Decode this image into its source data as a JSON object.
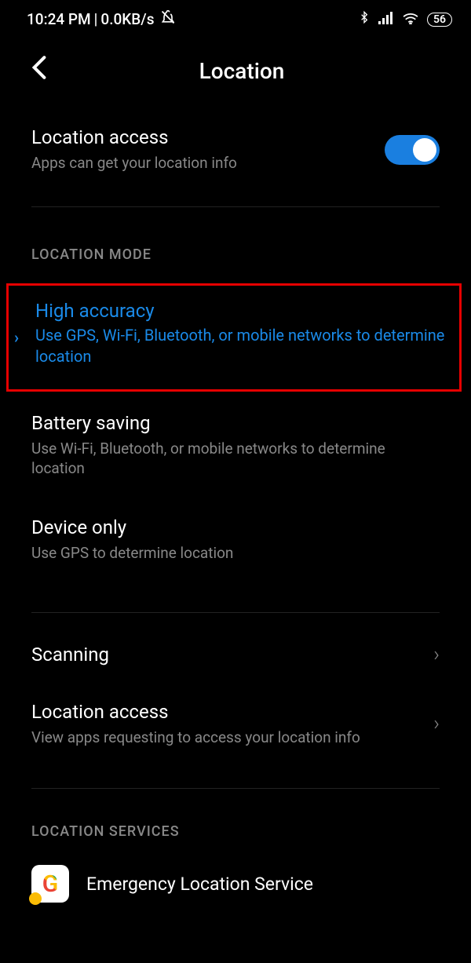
{
  "status": {
    "time": "10:24 PM",
    "speed": "0.0KB/s",
    "battery": "56"
  },
  "header": {
    "title": "Location"
  },
  "location_access": {
    "title": "Location access",
    "sub": "Apps can get your location info",
    "enabled": true
  },
  "section_mode": "LOCATION MODE",
  "modes": {
    "high": {
      "title": "High accuracy",
      "sub": "Use GPS, Wi-Fi, Bluetooth, or mobile networks to determine location"
    },
    "battery": {
      "title": "Battery saving",
      "sub": "Use Wi-Fi, Bluetooth, or mobile networks to determine location"
    },
    "device": {
      "title": "Device only",
      "sub": "Use GPS to determine location"
    }
  },
  "scanning": {
    "title": "Scanning"
  },
  "access_detail": {
    "title": "Location access",
    "sub": "View apps requesting to access your location info"
  },
  "section_services": "LOCATION SERVICES",
  "service_emergency": "Emergency Location Service"
}
